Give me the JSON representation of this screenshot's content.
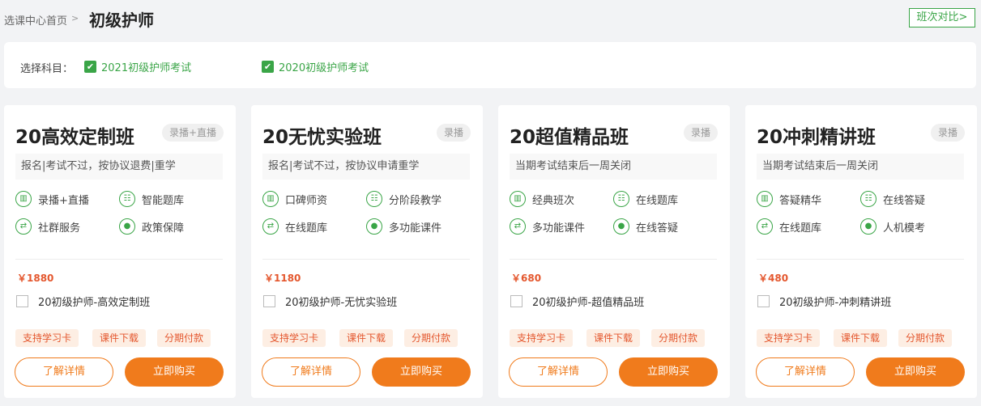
{
  "header": {
    "breadcrumb_home": "选课中心首页",
    "breadcrumb_sep": ">",
    "title": "初级护师",
    "compare_label": "班次对比>"
  },
  "filter": {
    "label": "选择科目：",
    "subjects": [
      {
        "label": "2021初级护师考试",
        "checked": true
      },
      {
        "label": "2020初级护师考试",
        "checked": true
      }
    ]
  },
  "colors": {
    "green": "#3aa547",
    "orange": "#f07b1c",
    "price": "#e4572e"
  },
  "cards": [
    {
      "title": "20高效定制班",
      "tag": "录播+直播",
      "note": "报名|考试不过，按协议退费|重学",
      "features": [
        "录播+直播",
        "智能题库",
        "社群服务",
        "政策保障"
      ],
      "price": "￥1880",
      "product": "20初级护师-高效定制班",
      "perks": [
        "支持学习卡",
        "课件下载",
        "分期付款"
      ],
      "detail_label": "了解详情",
      "buy_label": "立即购买"
    },
    {
      "title": "20无忧实验班",
      "tag": "录播",
      "note": "报名|考试不过，按协议申请重学",
      "features": [
        "口碑师资",
        "分阶段教学",
        "在线题库",
        "多功能课件"
      ],
      "price": "￥1180",
      "product": "20初级护师-无忧实验班",
      "perks": [
        "支持学习卡",
        "课件下载",
        "分期付款"
      ],
      "detail_label": "了解详情",
      "buy_label": "立即购买"
    },
    {
      "title": "20超值精品班",
      "tag": "录播",
      "note": "当期考试结束后一周关闭",
      "features": [
        "经典班次",
        "在线题库",
        "多功能课件",
        "在线答疑"
      ],
      "price": "￥680",
      "product": "20初级护师-超值精品班",
      "perks": [
        "支持学习卡",
        "课件下载",
        "分期付款"
      ],
      "detail_label": "了解详情",
      "buy_label": "立即购买"
    },
    {
      "title": "20冲刺精讲班",
      "tag": "录播",
      "note": "当期考试结束后一周关闭",
      "features": [
        "答疑精华",
        "在线答疑",
        "在线题库",
        "人机模考"
      ],
      "price": "￥480",
      "product": "20初级护师-冲刺精讲班",
      "perks": [
        "支持学习卡",
        "课件下载",
        "分期付款"
      ],
      "detail_label": "了解详情",
      "buy_label": "立即购买"
    }
  ]
}
